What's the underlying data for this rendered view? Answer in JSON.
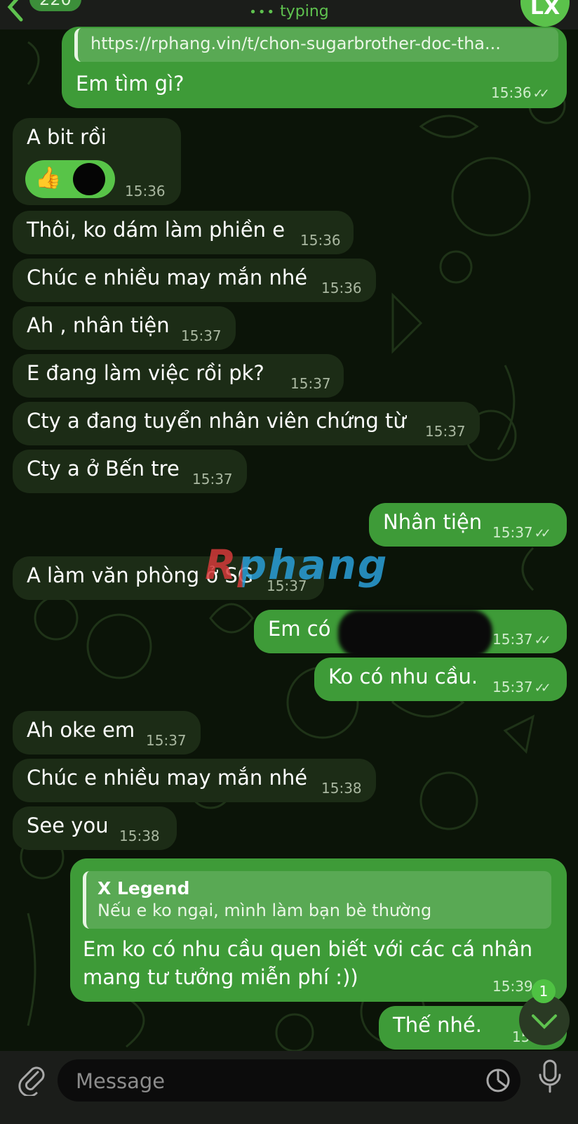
{
  "header": {
    "unread_count": "220",
    "status": "typing",
    "avatar_initials": "LX"
  },
  "messages": [
    {
      "id": "m1",
      "side": "out",
      "link": "https://rphang.vin/t/chon-sugarbrother-doc-tha...",
      "text": "Em tìm gì?",
      "time": "15:36"
    },
    {
      "id": "m2",
      "side": "in",
      "text": "A bit rồi",
      "reaction": "👍",
      "time": "15:36"
    },
    {
      "id": "m3",
      "side": "in",
      "text": "Thôi, ko dám làm phiền e",
      "time": "15:36"
    },
    {
      "id": "m4",
      "side": "in",
      "text": "Chúc e nhiều may mắn nhé",
      "time": "15:36"
    },
    {
      "id": "m5",
      "side": "in",
      "text": "Ah , nhân tiện",
      "time": "15:37"
    },
    {
      "id": "m6",
      "side": "in",
      "text": "E đang   làm việc rồi pk?",
      "time": "15:37"
    },
    {
      "id": "m7",
      "side": "in",
      "text": "Cty a đang tuyển nhân viên chứng từ",
      "time": "15:37"
    },
    {
      "id": "m8",
      "side": "in",
      "text": "Cty a ở Bến tre",
      "time": "15:37"
    },
    {
      "id": "m9",
      "side": "out",
      "text": "Nhân tiện",
      "time": "15:37"
    },
    {
      "id": "m10",
      "side": "in",
      "text": "A làm văn phòng ở SG",
      "time": "15:37"
    },
    {
      "id": "m11",
      "side": "out",
      "text": "Em có",
      "time": "15:37"
    },
    {
      "id": "m12",
      "side": "out",
      "text": "Ko có nhu cầu.",
      "time": "15:37"
    },
    {
      "id": "m13",
      "side": "in",
      "text": "Ah oke em",
      "time": "15:37"
    },
    {
      "id": "m14",
      "side": "in",
      "text": "Chúc e nhiều may mắn nhé",
      "time": "15:38"
    },
    {
      "id": "m15",
      "side": "in",
      "text": "See you",
      "time": "15:38"
    },
    {
      "id": "m16",
      "side": "out",
      "reply_name": "X Legend",
      "reply_text": "Nếu e ko ngại, mình làm bạn bè thường",
      "text_line1": "Em ko có nhu cầu quen biết với các cá nhân",
      "text_line2": "mang tư tưởng miễn phí :))",
      "time": "15:39"
    },
    {
      "id": "m17",
      "side": "out",
      "text": "Thế nhé.",
      "time": "15:39"
    }
  ],
  "watermark": "Rphang",
  "scroll_badge": "1",
  "composer": {
    "placeholder": "Message"
  },
  "colors": {
    "outgoing": "#3e9b38",
    "incoming": "#1c2c16",
    "accent": "#5fc24f"
  }
}
